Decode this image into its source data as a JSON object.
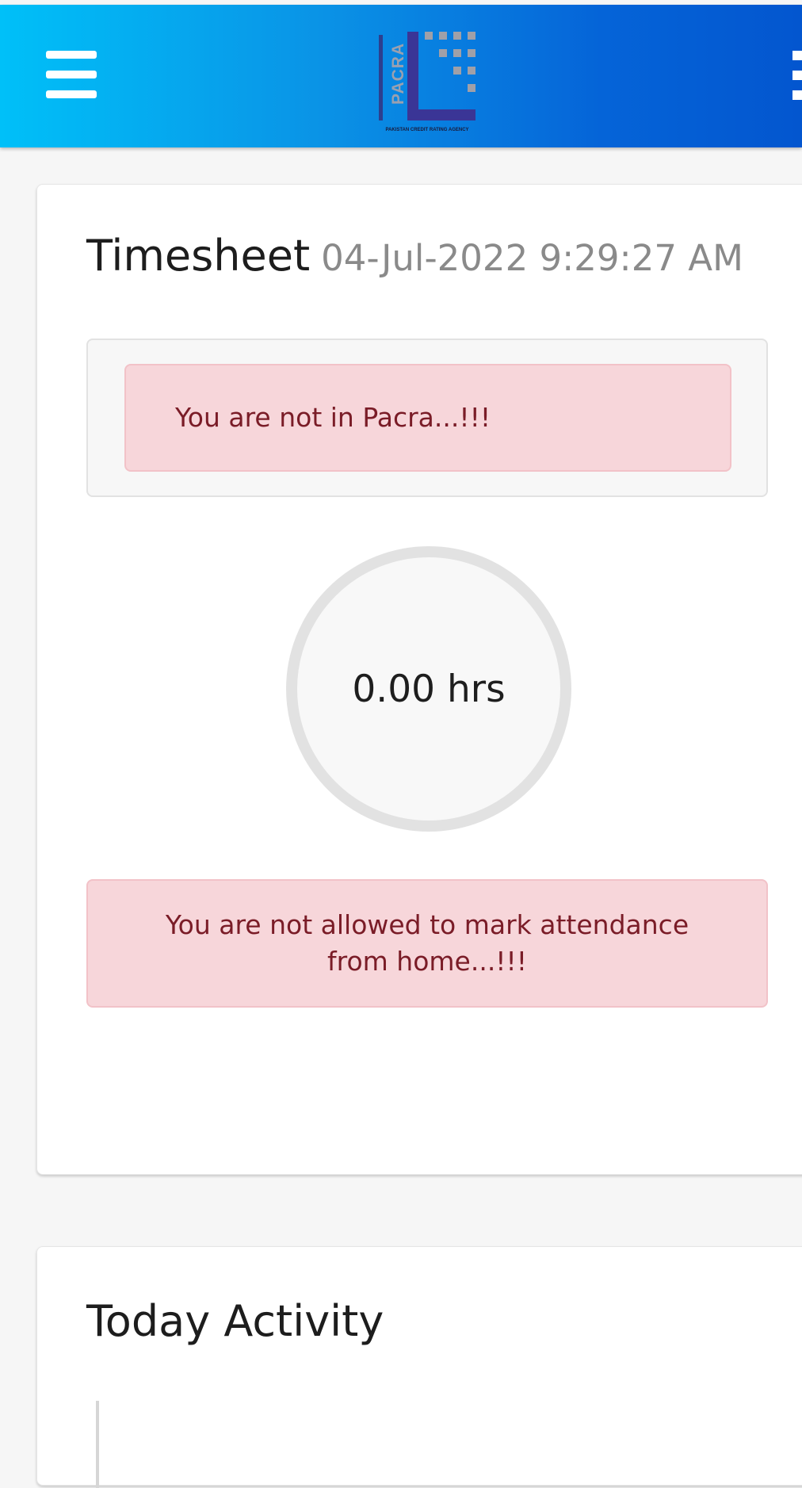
{
  "header": {
    "menu_icon": "hamburger-menu-icon",
    "more_icon": "vertical-ellipsis-icon",
    "logo": {
      "wordmark": "PACRA",
      "tagline": "PAKISTAN CREDIT RATING AGENCY"
    },
    "colors": {
      "gradient_start": "#00c0f8",
      "gradient_end": "#0356cf"
    }
  },
  "timesheet": {
    "title": "Timesheet",
    "datetime": "04-Jul-2022 9:29:27 AM",
    "location_alert": "You are not in Pacra...!!!",
    "hours": "0.00 hrs",
    "attendance_alert": "You are not allowed to mark attendance from home...!!!"
  },
  "activity": {
    "title": "Today Activity"
  },
  "colors": {
    "alert_background": "#f7d6da",
    "alert_text": "#7a1c27"
  }
}
